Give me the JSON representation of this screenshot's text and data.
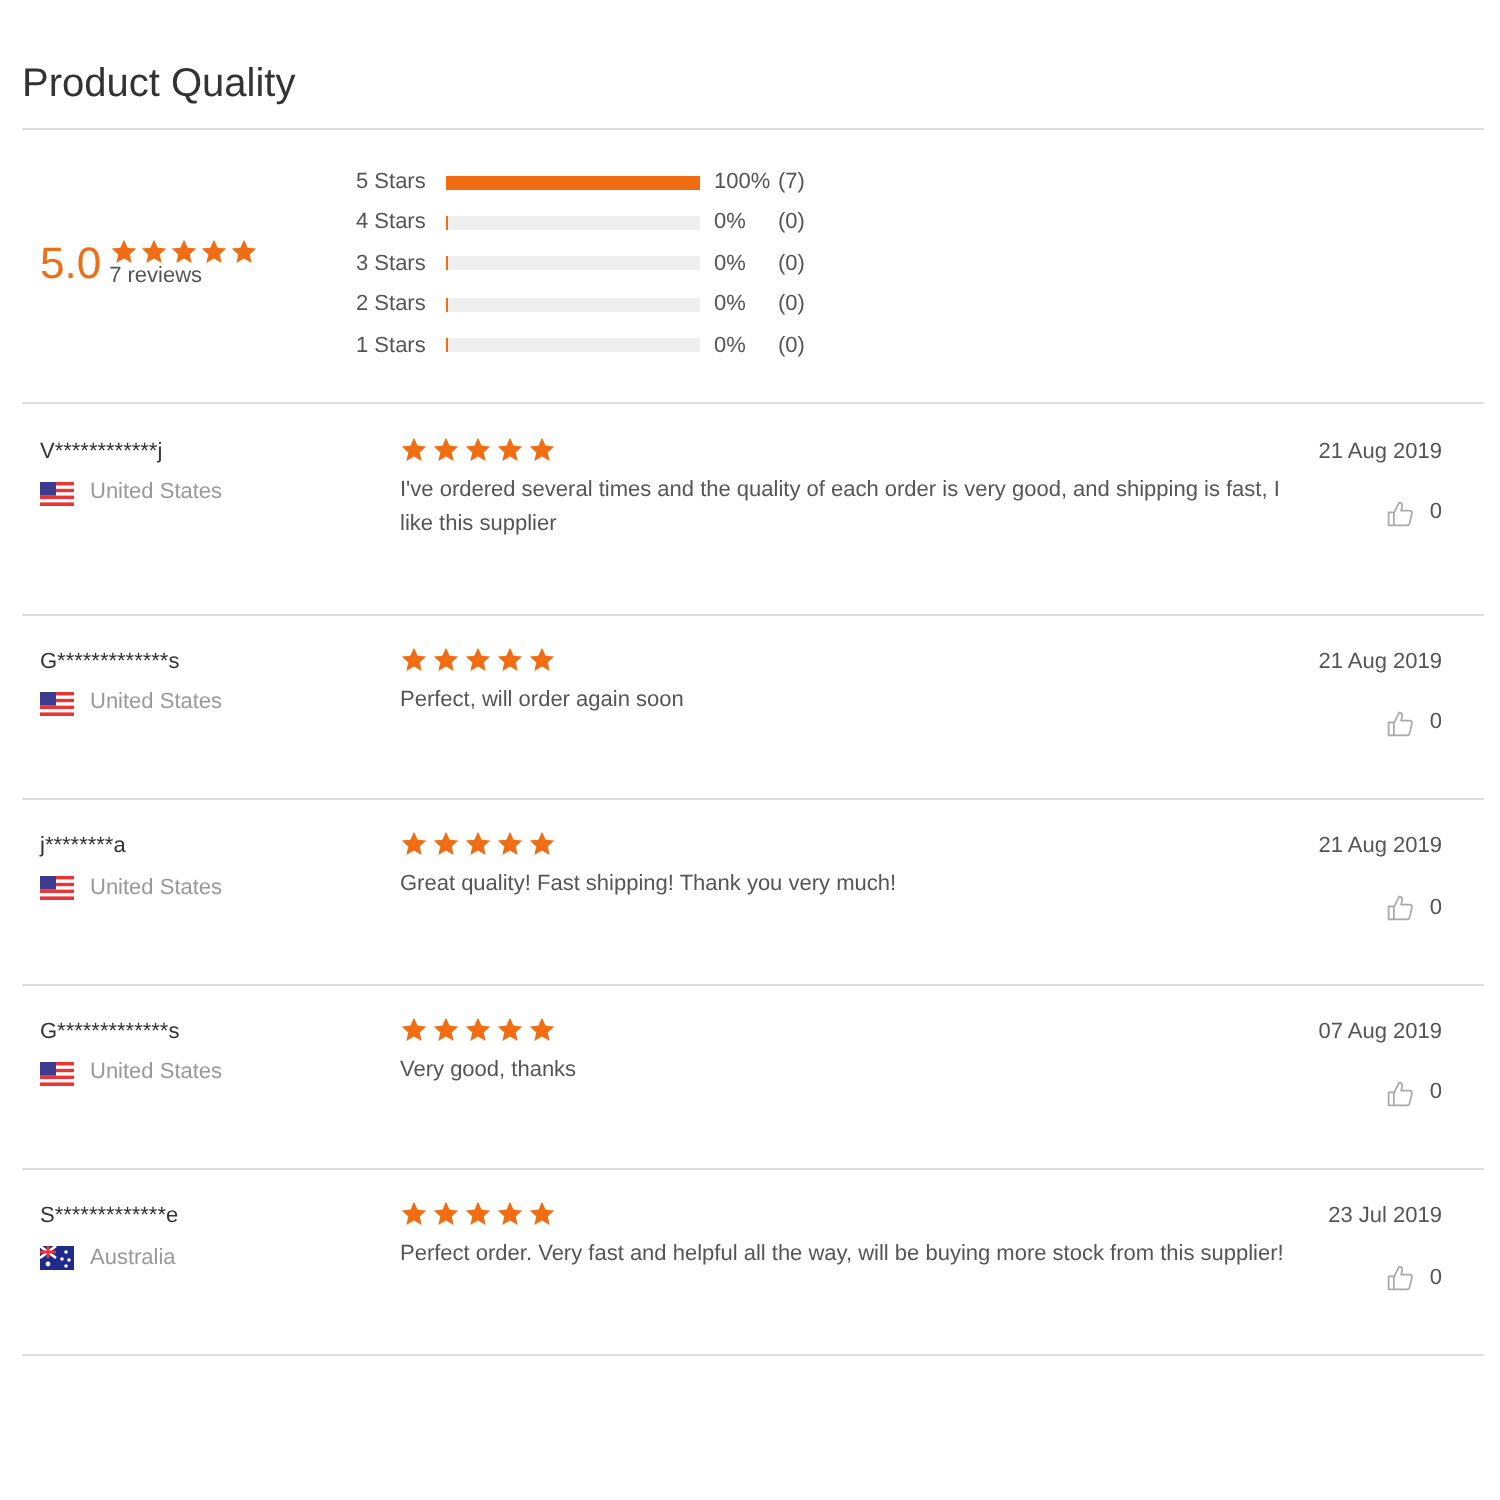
{
  "title": "Product Quality",
  "summary": {
    "score": "5.0",
    "stars": 5,
    "count": "7 reviews"
  },
  "histogram": [
    {
      "label": "5 Stars",
      "level": 1,
      "percent": "100%",
      "count": "(7)"
    },
    {
      "label": "4 Stars",
      "level": 0,
      "percent": "0%",
      "count": "(0)"
    },
    {
      "label": "3 Stars",
      "level": 0,
      "percent": "0%",
      "count": "(0)"
    },
    {
      "label": "2 Stars",
      "level": 0,
      "percent": "0%",
      "count": "(0)"
    },
    {
      "label": "1 Stars",
      "level": 0,
      "percent": "0%",
      "count": "(0)"
    }
  ],
  "reviews": [
    {
      "name": "V************j",
      "kind": "us",
      "country": "United States",
      "stars": 5,
      "text": "I've ordered several times and the quality of each order is very good, and shipping is fast, I like this supplier",
      "date": "21 Aug 2019",
      "likes": "0"
    },
    {
      "name": "G*************s",
      "kind": "us",
      "country": "United States",
      "stars": 5,
      "text": "Perfect, will order again soon",
      "date": "21 Aug 2019",
      "likes": "0"
    },
    {
      "name": "j********a",
      "kind": "us",
      "country": "United States",
      "stars": 5,
      "text": "Great quality! Fast shipping! Thank you very much!",
      "date": "21 Aug 2019",
      "likes": "0"
    },
    {
      "name": "G*************s",
      "kind": "us",
      "country": "United States",
      "stars": 5,
      "text": "Very good, thanks",
      "date": "07 Aug 2019",
      "likes": "0"
    },
    {
      "name": "S*************e",
      "kind": "au",
      "country": "Australia",
      "stars": 5,
      "text": "Perfect order.  Very fast and helpful all the way, will be buying more stock from this supplier!",
      "date": "23 Jul 2019",
      "likes": "0"
    }
  ]
}
